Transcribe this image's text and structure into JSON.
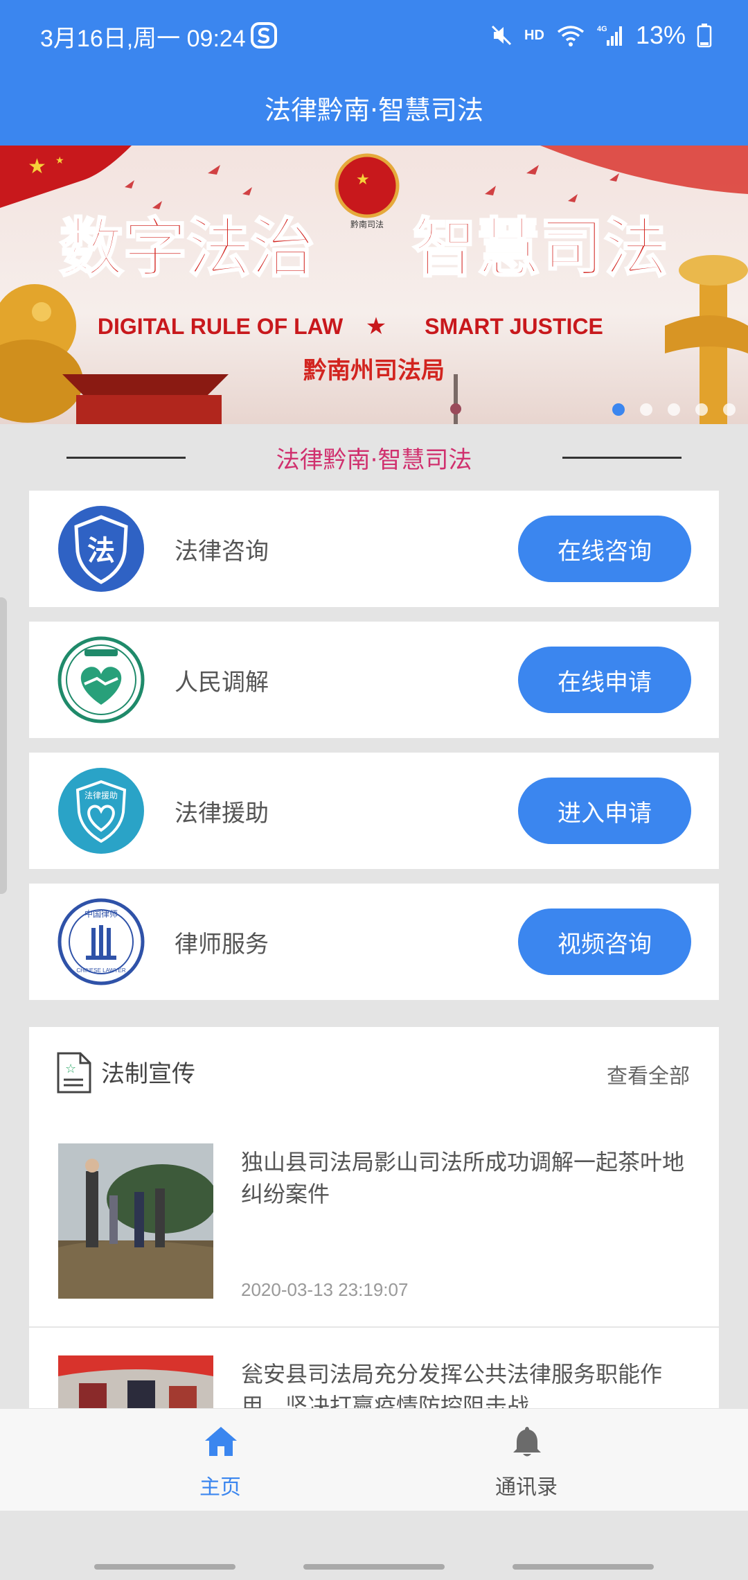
{
  "status_bar": {
    "time": "3月16日,周一  09:24",
    "network_badge": "HD",
    "battery": "13%",
    "icons": [
      "sogou-icon",
      "mute-icon",
      "wifi-icon",
      "signal-4g-icon",
      "battery-icon"
    ]
  },
  "app_bar": {
    "title": "法律黔南·智慧司法"
  },
  "banner": {
    "headline_left": "数字法治",
    "headline_right": "智慧司法",
    "subtitle_left": "DIGITAL RULE OF LAW",
    "subtitle_right": "SMART JUSTICE",
    "org": "黔南州司法局",
    "emblem_text": "黔南司法",
    "slide_count": 5,
    "active_slide": 1
  },
  "section": {
    "title": "法律黔南·智慧司法"
  },
  "services": [
    {
      "label": "法律咨询",
      "button": "在线咨询",
      "icon": "law-shield-icon",
      "icon_text": "法"
    },
    {
      "label": "人民调解",
      "button": "在线申请",
      "icon": "mediation-handshake-icon"
    },
    {
      "label": "法律援助",
      "button": "进入申请",
      "icon": "legal-aid-icon",
      "icon_text": "法律援助"
    },
    {
      "label": "律师服务",
      "button": "视频咨询",
      "icon": "chinese-lawyer-icon",
      "icon_text": "CHINESE LAWYER",
      "icon_text_cn": "中国律师"
    }
  ],
  "news": {
    "title": "法制宣传",
    "view_all": "查看全部",
    "items": [
      {
        "headline": "独山县司法局影山司法所成功调解一起茶叶地纠纷案件",
        "date": "2020-03-13 23:19:07"
      },
      {
        "headline": "瓮安县司法局充分发挥公共法律服务职能作用，坚决打赢疫情防控阻击战",
        "date": ""
      }
    ]
  },
  "tab_bar": {
    "home": "主页",
    "contacts": "通讯录"
  },
  "colors": {
    "primary": "#3b86ef",
    "accent_text": "#d0306e",
    "background": "#e4e4e4"
  }
}
